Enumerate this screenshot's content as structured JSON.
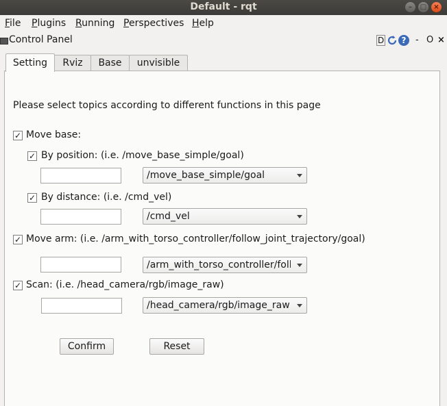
{
  "window": {
    "title": "Default - rqt"
  },
  "menubar": {
    "items": [
      {
        "first": "F",
        "rest": "ile"
      },
      {
        "first": "P",
        "rest": "lugins"
      },
      {
        "first": "R",
        "rest": "unning"
      },
      {
        "first": "P",
        "rest": "erspectives"
      },
      {
        "first": "H",
        "rest": "elp"
      }
    ]
  },
  "dock": {
    "title": "Control Panel",
    "d_label": "D",
    "help_label": "?",
    "min_label": "-",
    "float_label": "O",
    "close_label": "×"
  },
  "tabs": [
    "Setting",
    "Rviz",
    "Base",
    "unvisible"
  ],
  "setting": {
    "instruction": "Please select topics according to different functions in this page",
    "move_base": {
      "label": "Move base:",
      "checked": true
    },
    "by_position": {
      "label": "By position: (i.e.  /move_base_simple/goal)",
      "checked": true,
      "input": "",
      "combo": "/move_base_simple/goal"
    },
    "by_distance": {
      "label": "By distance: (i.e.  /cmd_vel)",
      "checked": true,
      "input": "",
      "combo": "/cmd_vel"
    },
    "move_arm": {
      "label": "Move arm: (i.e.  /arm_with_torso_controller/follow_joint_trajectory/goal)",
      "checked": true,
      "input": "",
      "combo": "/arm_with_torso_controller/foll"
    },
    "scan": {
      "label": "Scan: (i.e.  /head_camera/rgb/image_raw)",
      "checked": true,
      "input": "",
      "combo": "/head_camera/rgb/image_raw"
    },
    "confirm": "Confirm",
    "reset": "Reset"
  }
}
